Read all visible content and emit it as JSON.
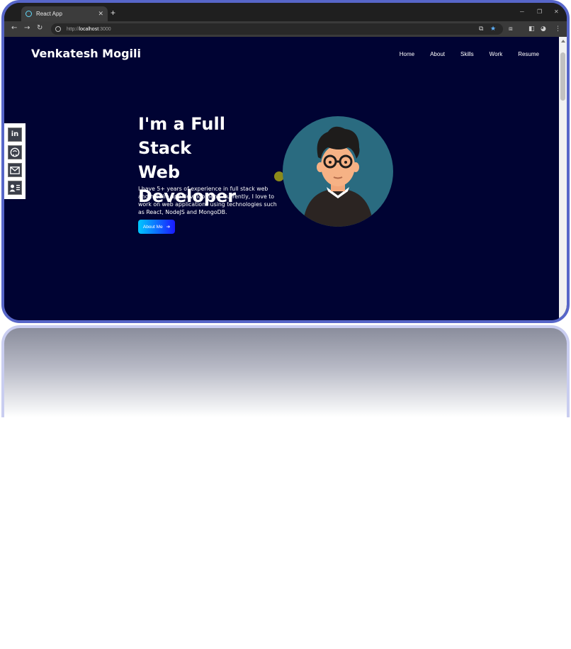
{
  "browser": {
    "tab_title": "React App",
    "tab_close": "✕",
    "new_tab": "+",
    "url_prefix": "http://",
    "url_host": "localhost",
    "url_suffix": ":3000",
    "window_minimize": "─",
    "window_restore": "❐",
    "window_close": "✕"
  },
  "page": {
    "brand": "Venkatesh Mogili",
    "nav": [
      "Home",
      "About",
      "Skills",
      "Work",
      "Resume"
    ],
    "hero_line1": "I'm a Full Stack",
    "hero_line2": "Web",
    "hero_line3": "Developer",
    "hero_text": "I have 5+ years of experience in full stack web and mobile app development. Currently, I love to work on web applications using technologies such as React, NodeJS and MongoDB.",
    "about_button": "About Me",
    "social_icons": [
      "linkedin-icon",
      "github-icon",
      "mail-icon",
      "contact-card-icon"
    ]
  },
  "colors": {
    "page_background": "#000333",
    "frame_border": "#5766c9",
    "button_gradient_start": "#00c8ff",
    "button_gradient_end": "#1a1aff",
    "avatar_circle": "#2a6b80"
  }
}
